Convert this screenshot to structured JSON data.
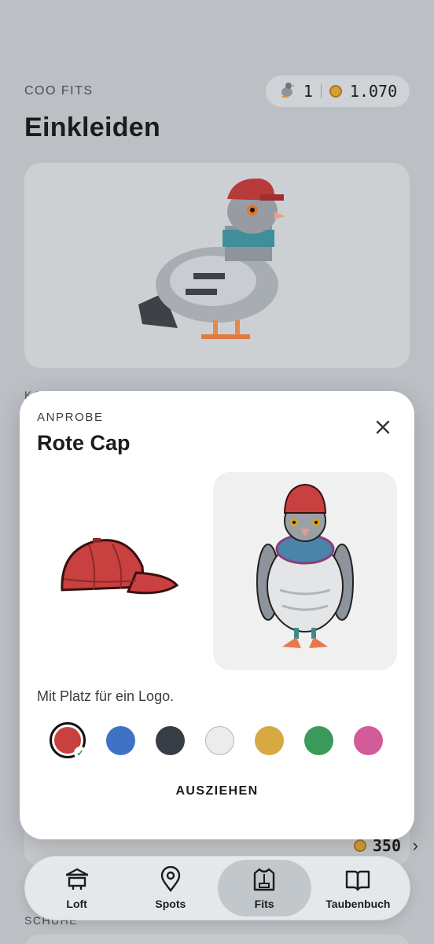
{
  "header": {
    "overline": "COO FITS",
    "title": "Einkleiden",
    "pigeon_count": "1",
    "coins": "1.070"
  },
  "background": {
    "section_stub": "KO",
    "item_price": "350",
    "section_bottom": "SCHUHE"
  },
  "sheet": {
    "overline": "ANPROBE",
    "title": "Rote Cap",
    "description": "Mit Platz für ein Logo.",
    "remove_label": "AUSZIEHEN",
    "selected_color": "#c94040",
    "colors": [
      "#c94040",
      "#3f72c4",
      "#383c44",
      "#ececea",
      "#d8a943",
      "#3a9a5b",
      "#d25b9a"
    ]
  },
  "tabbar": {
    "tabs": [
      {
        "label": "Loft",
        "icon": "loft-icon"
      },
      {
        "label": "Spots",
        "icon": "map-pin-icon"
      },
      {
        "label": "Fits",
        "icon": "hoodie-icon"
      },
      {
        "label": "Taubenbuch",
        "icon": "book-icon"
      }
    ],
    "active": "Fits"
  }
}
